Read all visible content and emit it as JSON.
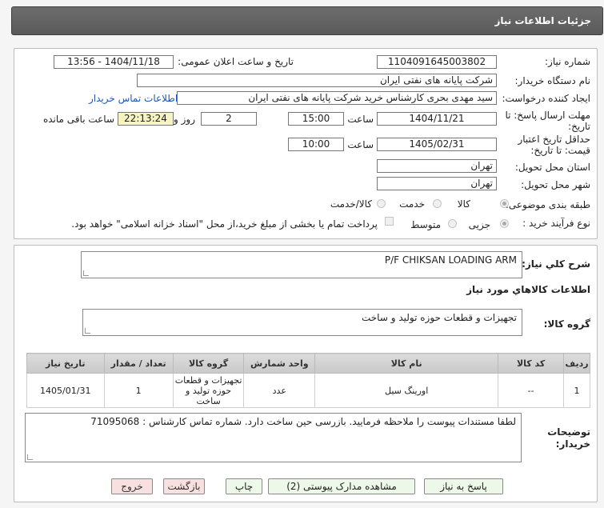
{
  "header": {
    "title": "جزئیات اطلاعات نیاز"
  },
  "form": {
    "need_number_label": "شماره نیاز:",
    "need_number": "1104091645003802",
    "announce_label": "تاریخ و ساعت اعلان عمومی:",
    "announce_value": "1404/11/18 - 13:56",
    "buyer_org_label": "نام دستگاه خریدار:",
    "buyer_org": "شرکت پایانه های نفتی ایران",
    "creator_label": "ایجاد کننده درخواست:",
    "creator": "سید مهدی  بحری کارشناس خرید شرکت پایانه های نفتی ایران",
    "contact_link": "اطلاعات تماس خریدار",
    "deadline_label_1": "مهلت ارسال پاسخ: تا",
    "deadline_label_2": "تاریخ:",
    "deadline_date": "1404/11/21",
    "time_label": "ساعت",
    "deadline_time": "15:00",
    "days_value": "2",
    "days_label": "روز و",
    "remaining_value": "22:13:24",
    "remaining_label": "ساعت باقی مانده",
    "validity_label_1": "حداقل تاریخ اعتبار",
    "validity_label_2": "قیمت: تا تاریخ:",
    "validity_date": "1405/02/31",
    "validity_time": "10:00",
    "province_label": "استان محل تحویل:",
    "province": "تهران",
    "city_label": "شهر محل تحویل:",
    "city": "تهران",
    "category_label": "طبقه بندی موضوعی:",
    "category_options": [
      "کالا",
      "خدمت",
      "کالا/خدمت"
    ],
    "process_label": "نوع فرآیند خرید :",
    "process_options": [
      "جزیی",
      "متوسط"
    ],
    "payment_note": "پرداخت تمام یا بخشی از مبلغ خرید،از محل \"اسناد خزانه اسلامی\" خواهد بود."
  },
  "details": {
    "summary_label": "شرح کلي نياز:",
    "summary": "P/F CHIKSAN LOADING ARM",
    "goods_info_label": "اطلاعات کالاهاي مورد نياز",
    "goods_group_label": "گروه کالا:",
    "goods_group": "تجهیزات و قطعات حوزه تولید و ساخت"
  },
  "table": {
    "headers": [
      "ردیف",
      "کد کالا",
      "نام کالا",
      "واحد شمارش",
      "گروه کالا",
      "تعداد / مقدار",
      "تاریخ نیاز"
    ],
    "rows": [
      [
        "1",
        "--",
        "اورینگ سیل",
        "عدد",
        "تجهیزات و قطعات حوزه تولید و ساخت",
        "1",
        "1405/01/31"
      ]
    ]
  },
  "notes": {
    "label_1": "توضیحات",
    "label_2": "خریدار:",
    "text": "لطفا مستندات پیوست را ملاحظه فرمایید. بازرسی حین ساخت دارد. شماره تماس کارشناس : 71095068"
  },
  "buttons": {
    "reply": "پاسخ به نیاز",
    "attachments": "مشاهده مدارک پیوستی (2)",
    "print": "چاپ",
    "back": "بازگشت",
    "exit": "خروج"
  }
}
